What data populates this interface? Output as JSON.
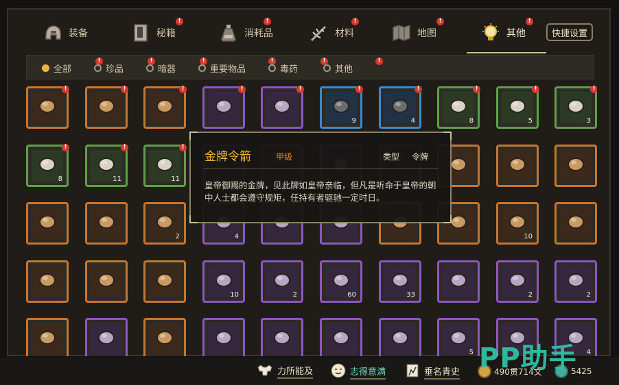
{
  "tabs": [
    {
      "label": "装备",
      "icon": "helmet-icon",
      "badge": false
    },
    {
      "label": "秘籍",
      "icon": "book-icon",
      "badge": true
    },
    {
      "label": "消耗品",
      "icon": "potion-icon",
      "badge": true
    },
    {
      "label": "材料",
      "icon": "herb-icon",
      "badge": true
    },
    {
      "label": "地图",
      "icon": "map-icon",
      "badge": true
    },
    {
      "label": "其他",
      "icon": "lightbulb-icon",
      "badge": true,
      "active": true
    }
  ],
  "quick_button": "快捷设置",
  "filters": [
    {
      "label": "全部",
      "selected": true,
      "badge": true
    },
    {
      "label": "珍品",
      "selected": false,
      "badge": true
    },
    {
      "label": "暗器",
      "selected": false,
      "badge": true
    },
    {
      "label": "重要物品",
      "selected": false,
      "badge": true
    },
    {
      "label": "毒药",
      "selected": false,
      "badge": true
    },
    {
      "label": "其他",
      "selected": false,
      "badge": true
    }
  ],
  "badge_mark": "!",
  "grid": [
    [
      {
        "rarity": "orange",
        "icon": "rope-ring-icon",
        "count": "",
        "badge": true
      },
      {
        "rarity": "orange",
        "icon": "necklace-icon",
        "count": "",
        "badge": true
      },
      {
        "rarity": "orange",
        "icon": "brush-icon",
        "count": "",
        "badge": true
      },
      {
        "rarity": "purple",
        "icon": "scroll-icon",
        "count": "",
        "badge": true
      },
      {
        "rarity": "purple",
        "icon": "key-icon",
        "count": "",
        "badge": true
      },
      {
        "rarity": "blue",
        "icon": "pot-icon",
        "count": "9",
        "badge": true
      },
      {
        "rarity": "blue",
        "icon": "jar-icon",
        "count": "4",
        "badge": true
      },
      {
        "rarity": "green",
        "icon": "salt-pile-icon",
        "count": "8",
        "badge": true
      },
      {
        "rarity": "green",
        "icon": "sticks-icon",
        "count": "5",
        "badge": true
      },
      {
        "rarity": "green",
        "icon": "shovel-icon",
        "count": "3",
        "badge": true
      }
    ],
    [
      {
        "rarity": "green",
        "icon": "cloth-icon",
        "count": "8",
        "badge": true
      },
      {
        "rarity": "green",
        "icon": "paper-icon",
        "count": "11",
        "badge": true
      },
      {
        "rarity": "green",
        "icon": "herb-plate-icon",
        "count": "11",
        "badge": true
      },
      {
        "rarity": "purple",
        "icon": "blank-icon",
        "count": "",
        "badge": false
      },
      {
        "rarity": "purple",
        "icon": "blank-icon",
        "count": "",
        "badge": false
      },
      {
        "rarity": "purple",
        "icon": "bowl-icon",
        "count": "",
        "badge": false
      },
      {
        "rarity": "purple",
        "icon": "blank-icon",
        "count": "",
        "badge": false
      },
      {
        "rarity": "orange",
        "icon": "ring-icon",
        "count": "",
        "badge": false
      },
      {
        "rarity": "orange",
        "icon": "ring-icon",
        "count": "",
        "badge": false
      },
      {
        "rarity": "orange",
        "icon": "bomb-icon",
        "count": "",
        "badge": false
      }
    ],
    [
      {
        "rarity": "orange",
        "icon": "map-scroll-icon",
        "count": "",
        "badge": false
      },
      {
        "rarity": "orange",
        "icon": "rolled-scroll-icon",
        "count": "",
        "badge": false
      },
      {
        "rarity": "orange",
        "icon": "ornate-key-icon",
        "count": "2",
        "badge": false
      },
      {
        "rarity": "purple",
        "icon": "red-pouch-icon",
        "count": "4",
        "badge": false
      },
      {
        "rarity": "purple",
        "icon": "scroll-icon",
        "count": "",
        "badge": false
      },
      {
        "rarity": "purple",
        "icon": "scroll-icon",
        "count": "",
        "badge": false
      },
      {
        "rarity": "orange",
        "icon": "scroll-icon",
        "count": "",
        "badge": false
      },
      {
        "rarity": "orange",
        "icon": "red-scroll-icon",
        "count": "",
        "badge": false
      },
      {
        "rarity": "orange",
        "icon": "gold-ingot-icon",
        "count": "10",
        "badge": false
      },
      {
        "rarity": "orange",
        "icon": "jade-statue-icon",
        "count": "",
        "badge": false
      }
    ],
    [
      {
        "rarity": "orange",
        "icon": "ink-stone-icon",
        "count": "",
        "badge": false
      },
      {
        "rarity": "orange",
        "icon": "tea-bowl-icon",
        "count": "",
        "badge": false
      },
      {
        "rarity": "orange",
        "icon": "porcelain-plate-icon",
        "count": "",
        "badge": false
      },
      {
        "rarity": "purple",
        "icon": "dagger-icon",
        "count": "10",
        "badge": false
      },
      {
        "rarity": "purple",
        "icon": "shuriken-icon",
        "count": "2",
        "badge": false
      },
      {
        "rarity": "purple",
        "icon": "iron-balls-icon",
        "count": "60",
        "badge": false
      },
      {
        "rarity": "purple",
        "icon": "gourd-icon",
        "count": "33",
        "badge": false
      },
      {
        "rarity": "purple",
        "icon": "needles-icon",
        "count": "",
        "badge": false
      },
      {
        "rarity": "purple",
        "icon": "silver-key-icon",
        "count": "2",
        "badge": false
      },
      {
        "rarity": "purple",
        "icon": "bronze-key-icon",
        "count": "2",
        "badge": false
      }
    ],
    [
      {
        "rarity": "orange",
        "icon": "token-icon",
        "count": "",
        "badge": false
      },
      {
        "rarity": "purple",
        "icon": "blue-letter-icon",
        "count": "",
        "badge": false
      },
      {
        "rarity": "orange",
        "icon": "jade-key-icon",
        "count": "",
        "badge": false
      },
      {
        "rarity": "purple",
        "icon": "box-icon",
        "count": "",
        "badge": false
      },
      {
        "rarity": "purple",
        "icon": "book-icon",
        "count": "",
        "badge": false
      },
      {
        "rarity": "purple",
        "icon": "red-book-icon",
        "count": "",
        "badge": false
      },
      {
        "rarity": "purple",
        "icon": "old-book-icon",
        "count": "",
        "badge": false
      },
      {
        "rarity": "purple",
        "icon": "tablet-icon",
        "count": "5",
        "badge": false
      },
      {
        "rarity": "purple",
        "icon": "pickaxe-icon",
        "count": "",
        "badge": false
      },
      {
        "rarity": "purple",
        "icon": "halberd-icon",
        "count": "4",
        "badge": false
      }
    ]
  ],
  "tooltip": {
    "title": "金牌令箭",
    "grade": "甲级",
    "type_label": "类型",
    "type_value": "令牌",
    "description": "皇帝御赐的金牌，见此牌如皇帝亲临，但凡是听命于皇帝的朝中人士都会遵守规矩，任持有者驱驰一定时日。"
  },
  "bottom": {
    "stats": [
      {
        "label": "力所能及",
        "icon": "strength-icon"
      },
      {
        "label": "志得意满",
        "icon": "smile-icon"
      },
      {
        "label": "垂名青史",
        "icon": "book-banner-icon"
      }
    ],
    "money": "490贯714文",
    "points": "5425"
  },
  "watermark": "PP助手",
  "colors": {
    "orange": "#c8752f",
    "purple": "#8e56c0",
    "blue": "#3b8ad0",
    "green": "#5ea047",
    "accent": "#f0b23a",
    "badge": "#d43a2b",
    "watermark": "#2fc1a4"
  }
}
